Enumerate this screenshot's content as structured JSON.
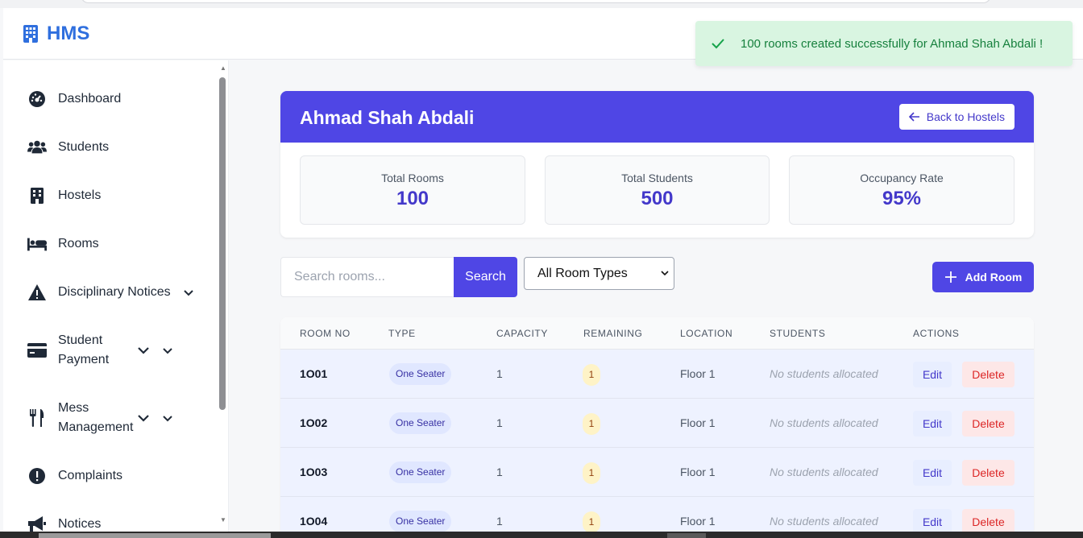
{
  "app": {
    "brand": "HMS"
  },
  "sidebar": {
    "items": [
      {
        "label": "Dashboard",
        "icon": "dashboard-icon"
      },
      {
        "label": "Students",
        "icon": "users-icon"
      },
      {
        "label": "Hostels",
        "icon": "building-icon"
      },
      {
        "label": "Rooms",
        "icon": "bed-icon"
      },
      {
        "label": "Disciplinary Notices",
        "icon": "warning-icon"
      },
      {
        "label": "Student Payment",
        "icon": "credit-card-icon"
      },
      {
        "label": "Mess Management",
        "icon": "utensils-icon"
      },
      {
        "label": "Complaints",
        "icon": "alert-circle-icon"
      },
      {
        "label": "Notices",
        "icon": "megaphone-icon"
      }
    ]
  },
  "toast": {
    "message": "100 rooms created successfully for Ahmad Shah Abdali !",
    "color": "#16803d"
  },
  "hostel": {
    "name": "Ahmad Shah Abdali",
    "back_label": "Back to Hostels",
    "stats": [
      {
        "label": "Total Rooms",
        "value": "100"
      },
      {
        "label": "Total Students",
        "value": "500"
      },
      {
        "label": "Occupancy Rate",
        "value": "95%"
      }
    ]
  },
  "toolbar": {
    "search_placeholder": "Search rooms...",
    "search_label": "Search",
    "type_filter": "All Room Types",
    "add_label": "Add Room"
  },
  "table": {
    "headers": [
      "ROOM NO",
      "TYPE",
      "CAPACITY",
      "REMAINING",
      "LOCATION",
      "STUDENTS",
      "ACTIONS"
    ],
    "rows": [
      {
        "room_no": "1O01",
        "type": "One Seater",
        "capacity": "1",
        "remaining": "1",
        "location": "Floor 1",
        "students": "No students allocated",
        "edit": "Edit",
        "delete": "Delete"
      },
      {
        "room_no": "1O02",
        "type": "One Seater",
        "capacity": "1",
        "remaining": "1",
        "location": "Floor 1",
        "students": "No students allocated",
        "edit": "Edit",
        "delete": "Delete"
      },
      {
        "room_no": "1O03",
        "type": "One Seater",
        "capacity": "1",
        "remaining": "1",
        "location": "Floor 1",
        "students": "No students allocated",
        "edit": "Edit",
        "delete": "Delete"
      },
      {
        "room_no": "1O04",
        "type": "One Seater",
        "capacity": "1",
        "remaining": "1",
        "location": "Floor 1",
        "students": "No students allocated",
        "edit": "Edit",
        "delete": "Delete"
      }
    ]
  },
  "colors": {
    "primary": "#4f46e5",
    "brand": "#2f6fde",
    "danger": "#dc2626"
  }
}
